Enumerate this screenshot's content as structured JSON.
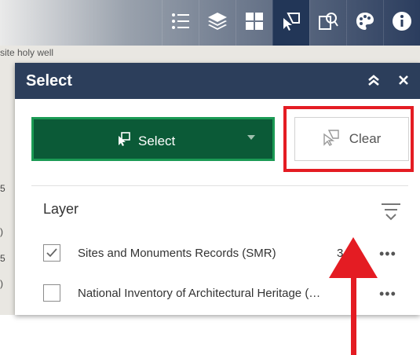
{
  "map": {
    "label_top": "site   holy well",
    "edge_texts": [
      "5",
      ")",
      "5",
      ")"
    ]
  },
  "toolbar": {
    "buttons": [
      {
        "icon": "legend-icon",
        "active": false
      },
      {
        "icon": "layers-icon",
        "active": false
      },
      {
        "icon": "grid-icon",
        "active": false
      },
      {
        "icon": "select-icon",
        "active": true
      },
      {
        "icon": "query-icon",
        "active": false
      },
      {
        "icon": "palette-icon",
        "active": false
      },
      {
        "icon": "info-icon",
        "active": false
      }
    ]
  },
  "panel": {
    "title": "Select",
    "collapse_icon": "double-chevron-up-icon",
    "close_icon": "close-icon",
    "select_label": "Select",
    "clear_label": "Clear",
    "layer_header": "Layer",
    "layers": [
      {
        "label": "Sites and Monuments Records (SMR)",
        "count": "3",
        "checked": true
      },
      {
        "label": "National Inventory of Architectural Heritage (…",
        "count": "",
        "checked": false
      }
    ],
    "more_label": "•••"
  },
  "colors": {
    "header_bg": "#2c3e5b",
    "select_bg": "#0b5a37",
    "select_border": "#1b9a54",
    "highlight": "#e41c23"
  }
}
